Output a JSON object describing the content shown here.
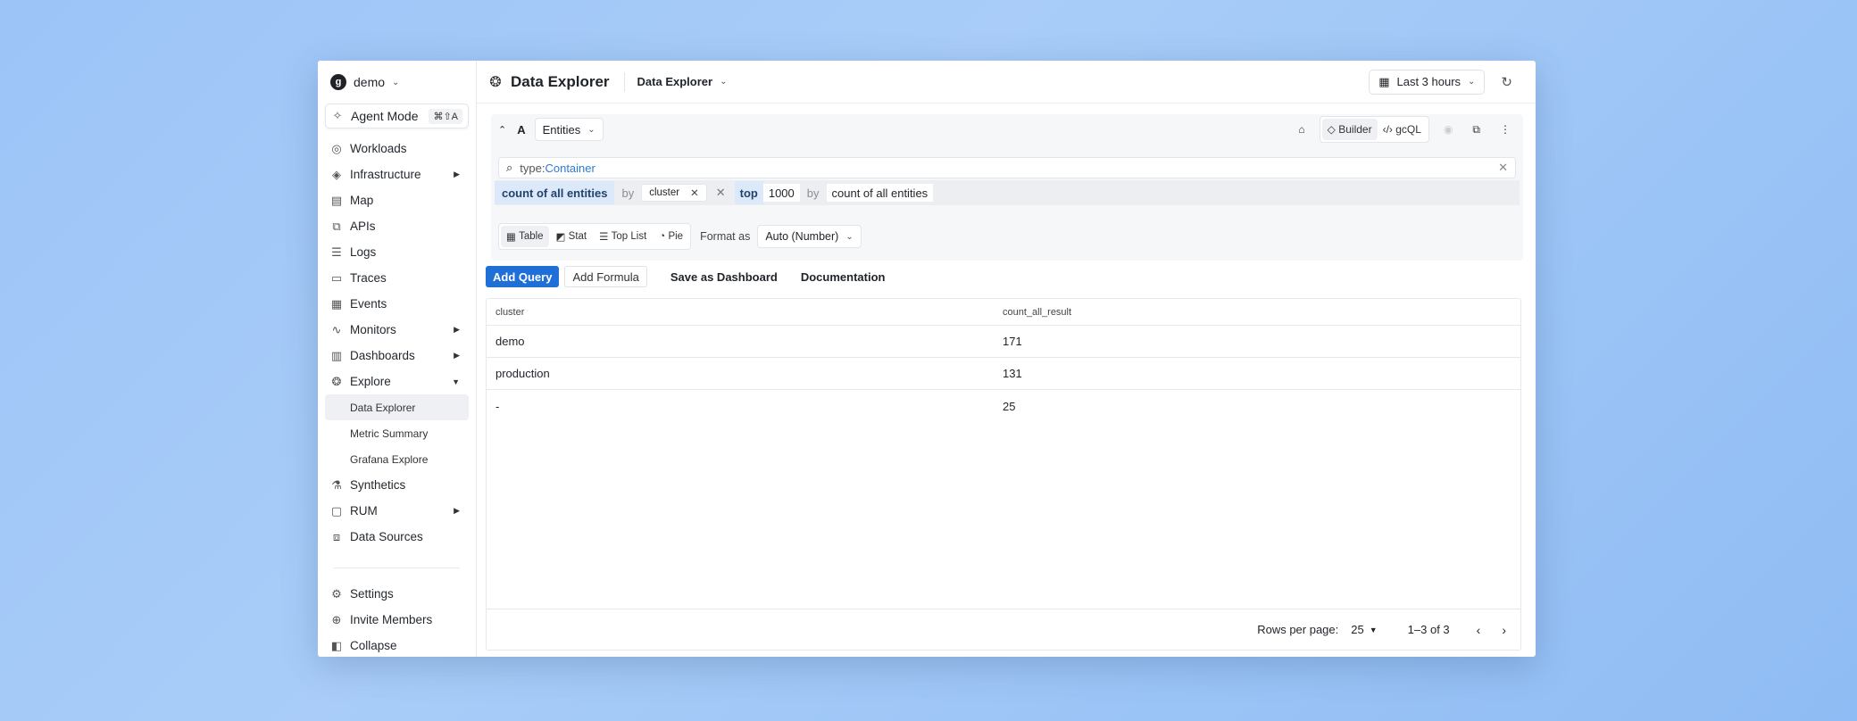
{
  "sidebar": {
    "org_initial": "g",
    "org_name": "demo",
    "agent_mode": "Agent Mode",
    "agent_shortcut": "⌘⇧A",
    "items": [
      {
        "label": "Workloads"
      },
      {
        "label": "Infrastructure"
      },
      {
        "label": "Map"
      },
      {
        "label": "APIs"
      },
      {
        "label": "Logs"
      },
      {
        "label": "Traces"
      },
      {
        "label": "Events"
      },
      {
        "label": "Monitors"
      },
      {
        "label": "Dashboards"
      },
      {
        "label": "Explore"
      },
      {
        "label": "Synthetics"
      },
      {
        "label": "RUM"
      },
      {
        "label": "Data Sources"
      }
    ],
    "explore_sub": [
      "Data Explorer",
      "Metric Summary",
      "Grafana Explore"
    ],
    "bottom": [
      {
        "label": "Settings"
      },
      {
        "label": "Invite Members"
      },
      {
        "label": "Collapse"
      }
    ]
  },
  "header": {
    "title": "Data Explorer",
    "breadcrumb": "Data Explorer",
    "time_range": "Last 3 hours"
  },
  "query": {
    "letter": "A",
    "source": "Entities",
    "mode_builder": "Builder",
    "mode_gcql": "gcQL",
    "search_key": "type:",
    "search_value": "Container",
    "aggregation": "count of all entities",
    "by_word": "by",
    "group_by": "cluster",
    "top_word": "top",
    "top_n": "1000",
    "order_by": "count of all entities"
  },
  "viz": {
    "options": [
      "Table",
      "Stat",
      "Top List",
      "Pie"
    ],
    "format_label": "Format as",
    "format_value": "Auto (Number)"
  },
  "actions": {
    "add_query": "Add Query",
    "add_formula": "Add Formula",
    "save_dashboard": "Save as Dashboard",
    "documentation": "Documentation"
  },
  "table": {
    "columns": [
      "cluster",
      "count_all_result"
    ],
    "rows": [
      [
        "demo",
        "171"
      ],
      [
        "production",
        "131"
      ],
      [
        "-",
        "25"
      ]
    ],
    "rows_per_page_label": "Rows per page:",
    "rows_per_page": "25",
    "range": "1–3 of 3"
  }
}
